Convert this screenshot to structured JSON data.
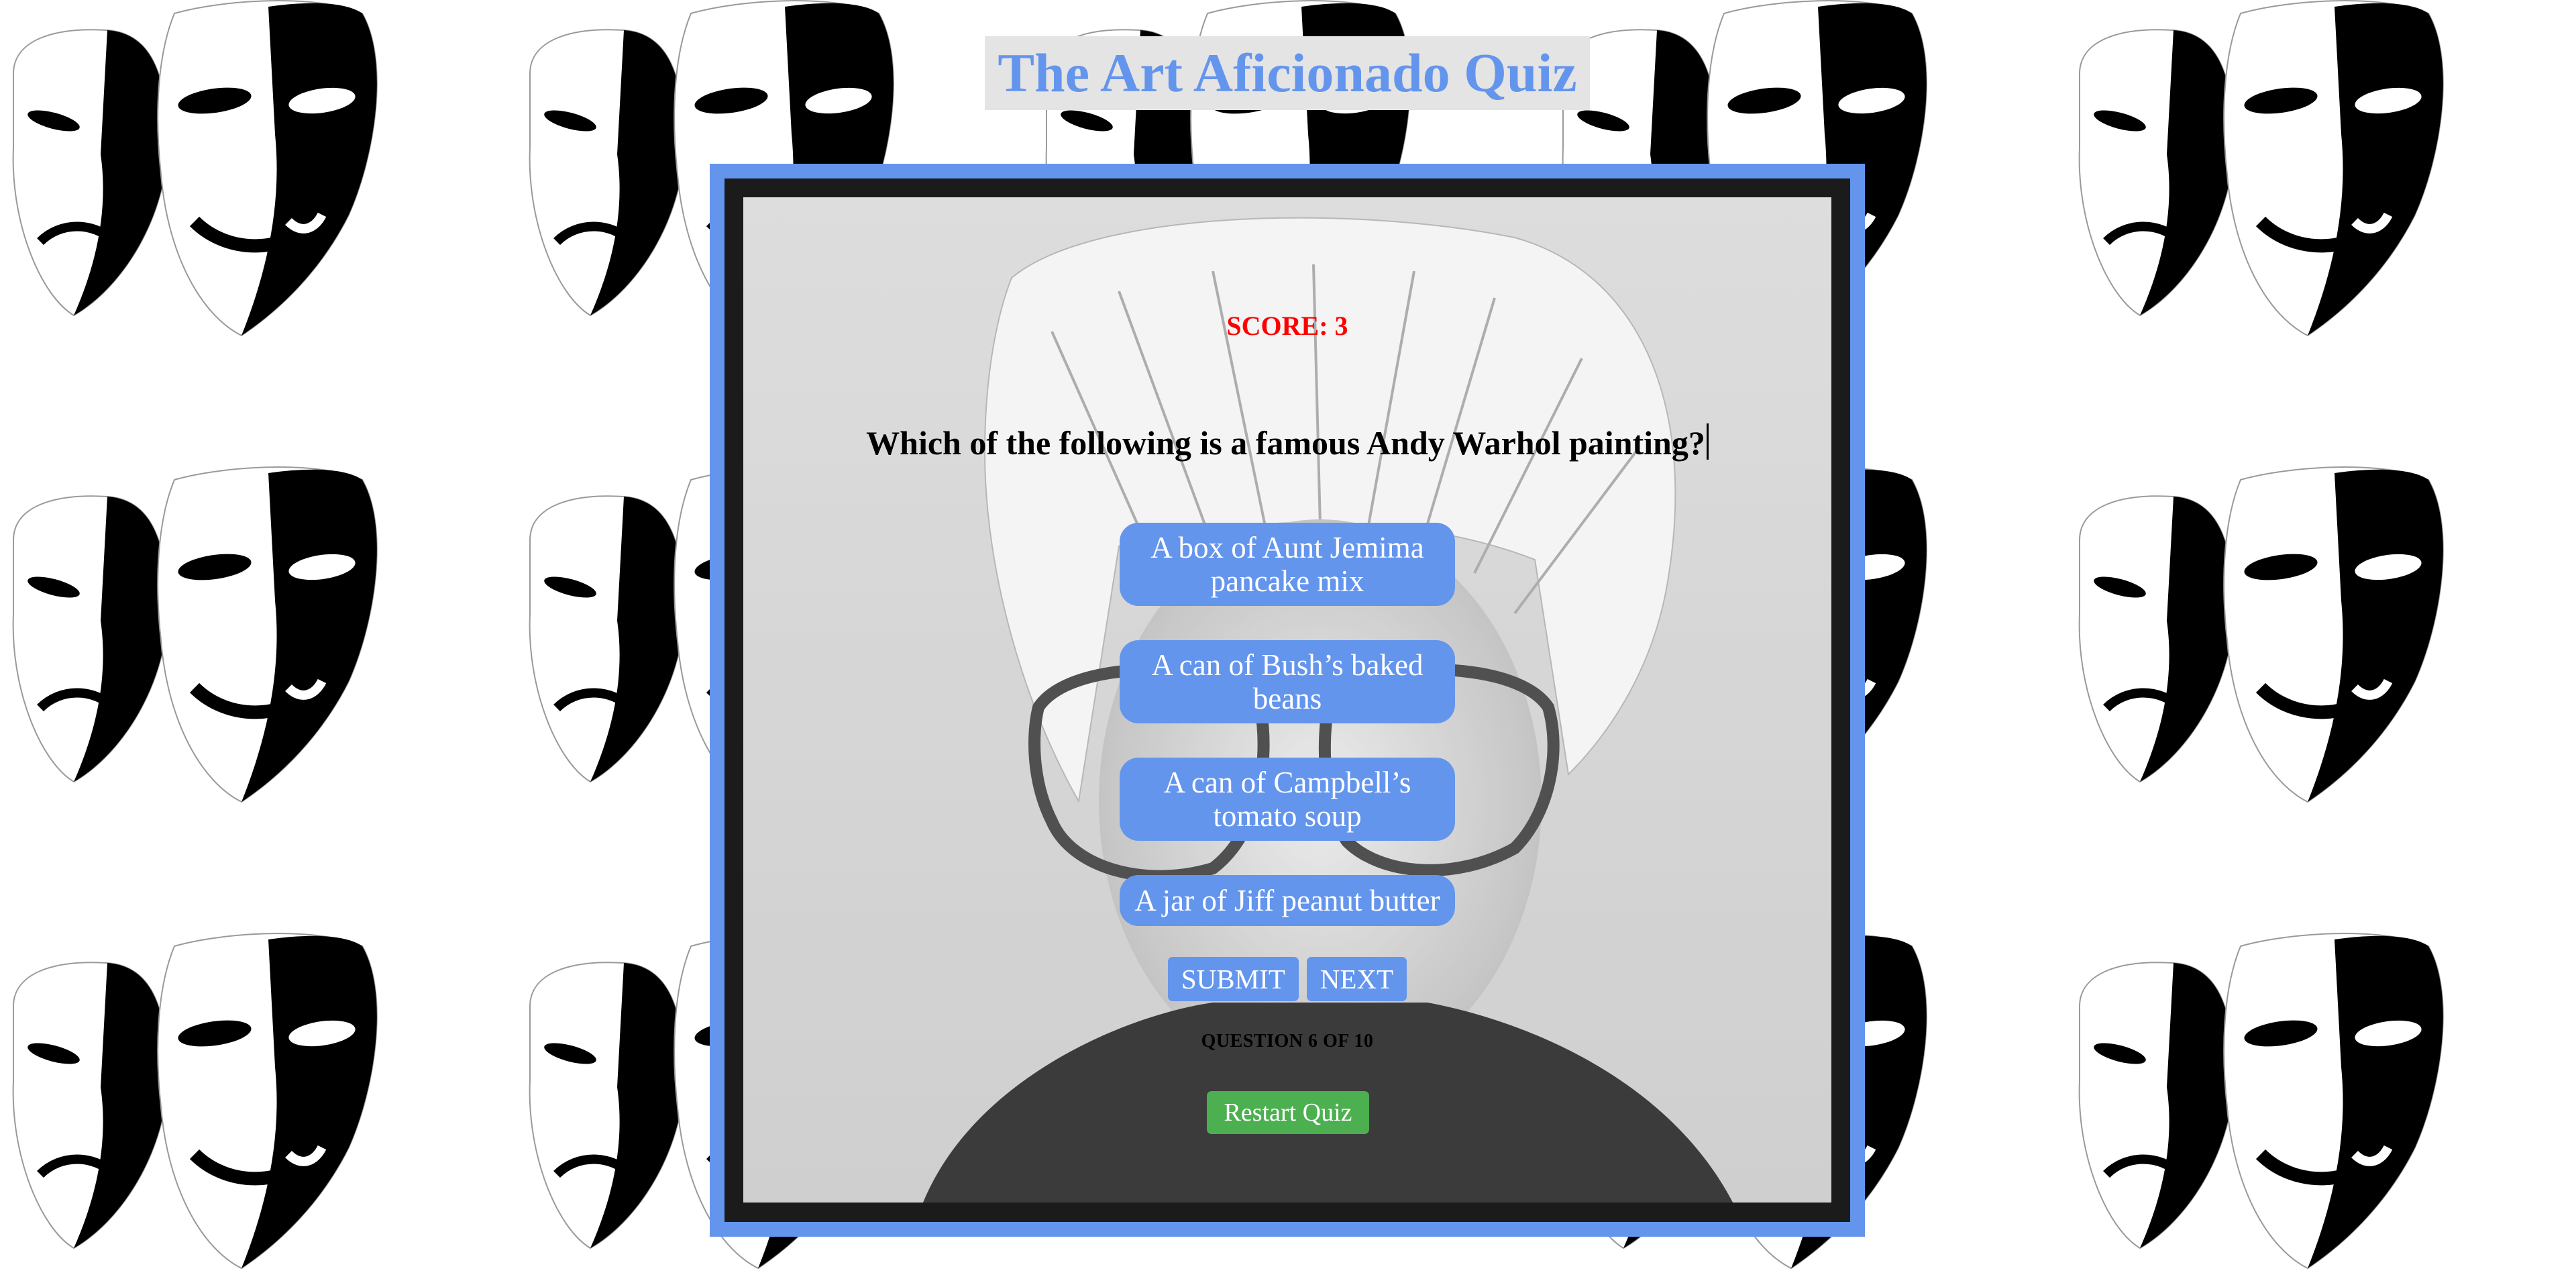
{
  "page": {
    "title": "The Art Aficionado Quiz"
  },
  "quiz": {
    "score_text": "SCORE: 3",
    "question": "Which of the following is a famous Andy Warhol painting?",
    "answers": [
      {
        "label": "A box of Aunt Jemima pancake mix"
      },
      {
        "label": "A can of Bush’s baked beans"
      },
      {
        "label": "A can of Campbell’s tomato soup"
      },
      {
        "label": "A jar of Jiff peanut butter"
      }
    ],
    "submit_label": "SUBMIT",
    "next_label": "NEXT",
    "progress_text": "QUESTION 6 OF 10",
    "restart_label": "Restart Quiz"
  },
  "colors": {
    "accent": "#6495ed",
    "title_bg": "#e4e4e4",
    "score": "#ff0000",
    "restart": "#4caf50"
  },
  "icons": {
    "background": "theater-masks-icon",
    "portrait": "andy-warhol-portrait"
  }
}
